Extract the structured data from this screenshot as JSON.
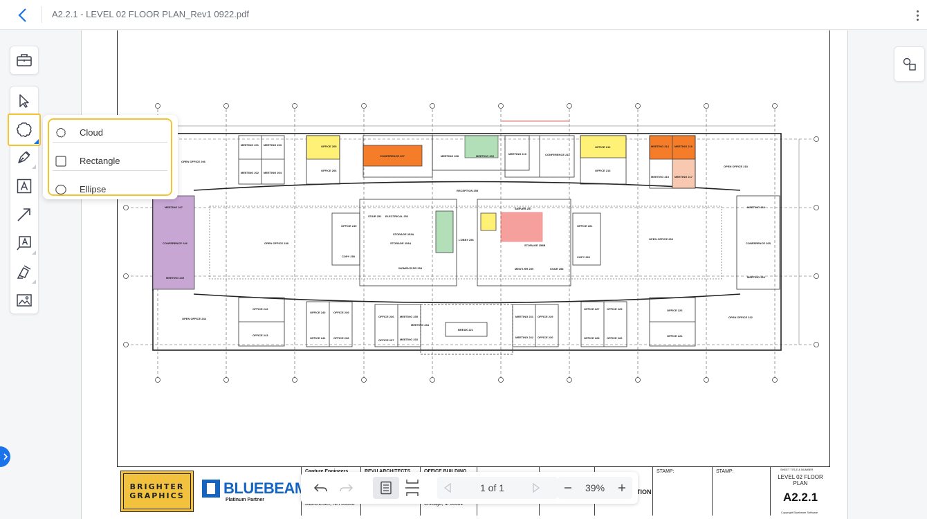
{
  "header": {
    "doc_title": "A2.2.1 - LEVEL 02 FLOOR PLAN_Rev1 0922.pdf"
  },
  "shape_menu": {
    "items": [
      {
        "label": "Cloud",
        "icon": "cloud-icon"
      },
      {
        "label": "Rectangle",
        "icon": "rectangle-icon"
      },
      {
        "label": "Ellipse",
        "icon": "ellipse-icon"
      }
    ]
  },
  "toolbar": {
    "tools": [
      "toolbox-icon",
      "select-arrow-icon",
      "cloud-shape-icon",
      "pen-icon",
      "text-icon",
      "arrow-line-icon",
      "text-box-icon",
      "highlighter-icon",
      "image-icon"
    ]
  },
  "navbar": {
    "page_label": "1 of 1",
    "zoom_label": "39%"
  },
  "titleblock": {
    "logo_line1": "BRIGHTER",
    "logo_line2": "GRAPHICS",
    "bluebeam_word": "BLUEBEAM",
    "bluebeam_sub": "Platinum Partner",
    "col1": "Capture Engineers",
    "col1_sub": "Manchester, NH 03030",
    "col2": "REVU ARCHITECTS",
    "col3": "OFFICE BUILDING",
    "col3_sub": "Chicago, IL 60601",
    "col6_tail": "TION",
    "stamp1": "STAMP:",
    "stamp2": "STAMP:",
    "sheet_title_label": "SHEET TITLE & NUMBER",
    "sheet_title": "LEVEL 02 FLOOR PLAN",
    "sheet_number": "A2.2.1",
    "copyright": "Copyright Bluebeam Software"
  },
  "plan": {
    "rooms": {
      "open_office_206": "OPEN OFFICE 206",
      "meeting_201": "MEETING 201",
      "meeting_203": "MEETING 203",
      "meeting_202": "MEETING 202",
      "meeting_204": "MEETING 204",
      "office_205": "OFFICE 205",
      "office_206": "OFFICE 206",
      "conference_207": "CONFERENCE 207",
      "meeting_208": "MEETING 208",
      "meeting_209": "MEETING 209",
      "meeting_210": "MEETING 210",
      "conference_211": "CONFERENCE 211",
      "office_212": "OFFICE 212",
      "office_213": "OFFICE 213",
      "meeting_214": "MEETING 214",
      "meeting_216": "MEETING 216",
      "meeting_215": "MEETING 215",
      "meeting_217": "MEETING 217",
      "open_office_218": "OPEN OFFICE 218",
      "reception_255": "RECEPTION 255",
      "meeting_247": "MEETING 247",
      "conference_246": "CONFERENCE 246",
      "meeting_245": "MEETING 245",
      "open_office_248": "OPEN OFFICE 248",
      "office_249": "OFFICE 249",
      "copy_250": "COPY 250",
      "stair_251": "STAIR 251",
      "electrical_252": "ELECTRICAL 252",
      "storage_253a": "STORAGE 253A",
      "storage_254a": "STORAGE 254A",
      "womens_rr": "WOMEN'S RR 254",
      "lobby_256": "LOBBY 256",
      "server_257": "SERVER 257",
      "storage_258": "STORAGE 258B",
      "mens_rr": "MEN'S RR 259",
      "stair_258": "STAIR 258",
      "office_261": "OFFICE 261",
      "copy_262": "COPY 262",
      "open_office_263": "OPEN OFFICE 263",
      "meeting_264": "MEETING 264",
      "conference_265": "CONFERENCE 265",
      "meeting_266": "MEETING 266",
      "open_office_244": "OPEN OFFICE 244",
      "office_242": "OFFICE 242",
      "office_243": "OFFICE 243",
      "office_240": "OFFICE 240",
      "office_239": "OFFICE 239",
      "office_241": "OFFICE 241",
      "office_238": "OFFICE 238",
      "office_236": "OFFICE 236",
      "meeting_235": "MEETING 235",
      "meeting_234": "MEETING 234",
      "office_237": "OFFICE 237",
      "meeting_233": "MEETING 233",
      "break_221": "BREAK 221",
      "meeting_231": "MEETING 231",
      "office_229": "OFFICE 229",
      "meeting_232": "MEETING 232",
      "office_230": "OFFICE 230",
      "office_227": "OFFICE 227",
      "office_225": "OFFICE 225",
      "office_228": "OFFICE 228",
      "office_226": "OFFICE 226",
      "office_223": "OFFICE 223",
      "office_224": "OFFICE 224",
      "open_office_222": "OPEN OFFICE 222"
    },
    "colors": {
      "yellow": "#fff176",
      "orange": "#f57c28",
      "green": "#b2dfb8",
      "purple": "#c7a6d4",
      "red": "#ef5350",
      "peach": "#f8c9b0"
    }
  }
}
